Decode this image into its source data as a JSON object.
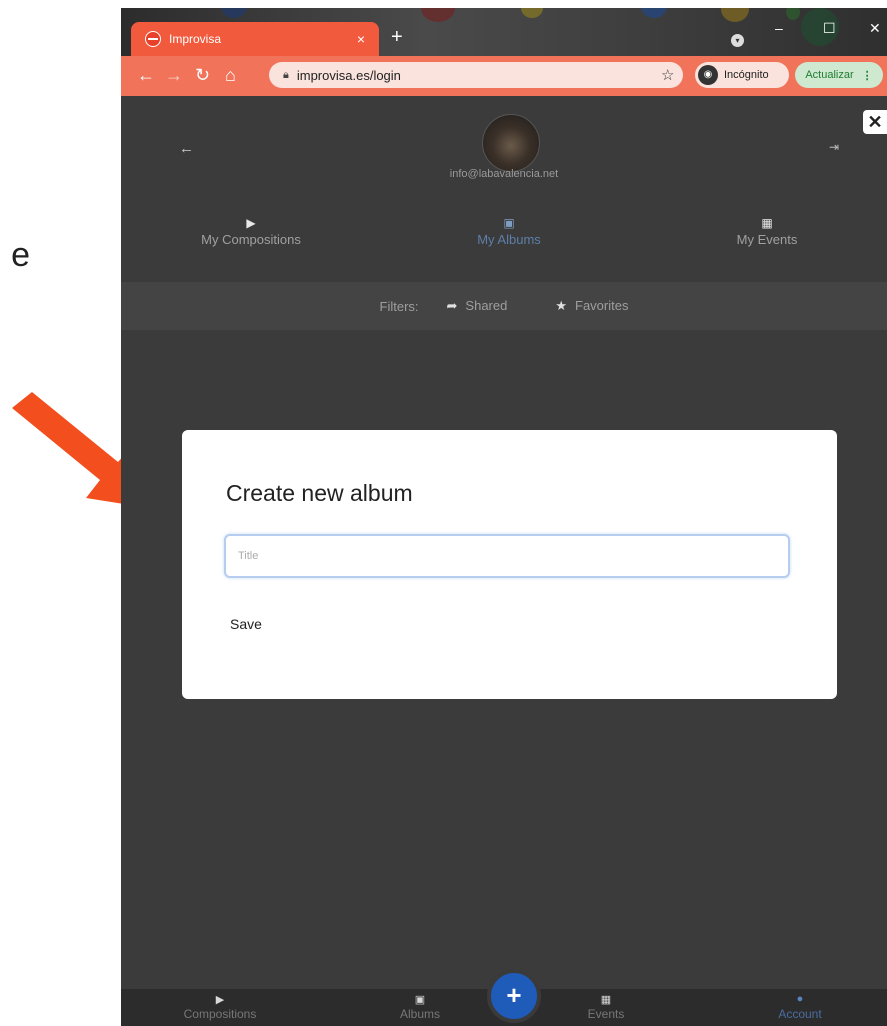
{
  "annotation": {
    "side_text": "e",
    "arrow_color": "#f24e1e"
  },
  "browser": {
    "tab_title": "Improvisa",
    "tab_close": "×",
    "new_tab": "+",
    "url": "improvisa.es/login",
    "incognito_label": "Incógnito",
    "update_label": "Actualizar",
    "accent": "#f0735a"
  },
  "page": {
    "email": "info@labavalencia.net",
    "tabs": [
      {
        "label": "My Compositions",
        "icon": "play-icon"
      },
      {
        "label": "My Albums",
        "icon": "album-icon"
      },
      {
        "label": "My Events",
        "icon": "calendar-icon"
      }
    ],
    "filters": {
      "label": "Filters:",
      "shared": "Shared",
      "favorites": "Favorites"
    }
  },
  "modal": {
    "title": "Create new album",
    "input_placeholder": "Title",
    "save_label": "Save"
  },
  "bottom_nav": {
    "items": [
      {
        "label": "Compositions",
        "icon": "play-icon"
      },
      {
        "label": "Albums",
        "icon": "album-icon"
      },
      {
        "label": "Events",
        "icon": "calendar-icon"
      },
      {
        "label": "Account",
        "icon": "user-circle-icon"
      }
    ],
    "fab": "+"
  }
}
